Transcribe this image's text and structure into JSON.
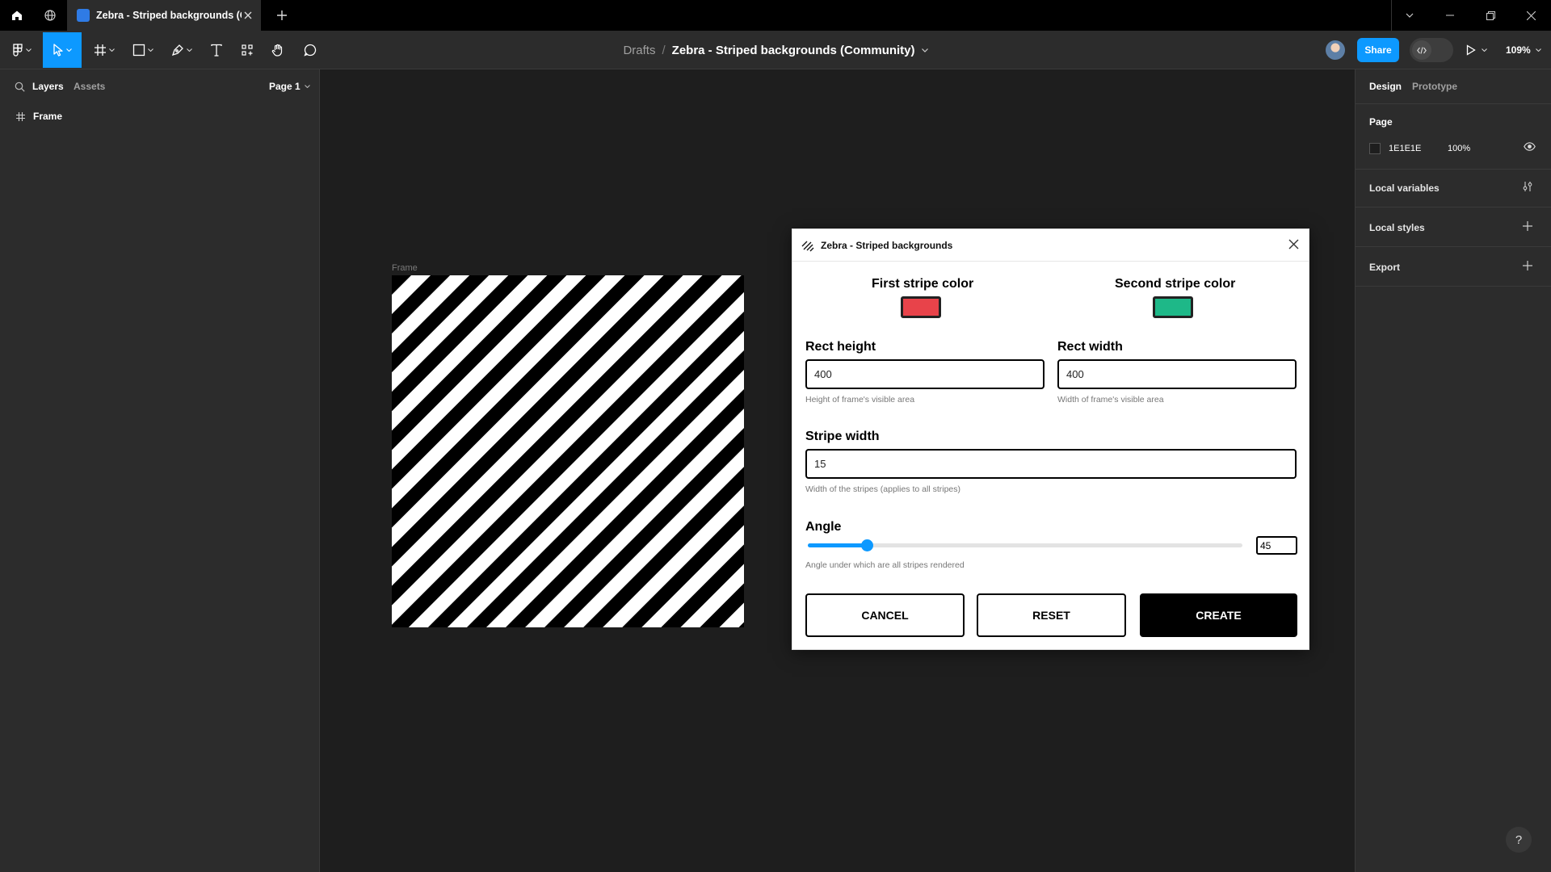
{
  "tabbar": {
    "tab_title": "Zebra - Striped backgrounds (Com",
    "home_icon": "home-icon",
    "community_icon": "globe-icon",
    "new_tab_icon": "plus-icon"
  },
  "toolbar": {
    "breadcrumb_root": "Drafts",
    "breadcrumb_separator": "/",
    "file_name": "Zebra - Striped backgrounds (Community)",
    "share_label": "Share",
    "zoom": "109%",
    "accent": "#0d99ff"
  },
  "left_panel": {
    "tabs": [
      "Layers",
      "Assets"
    ],
    "page_selector": "Page 1",
    "layers": [
      {
        "name": "Frame",
        "icon": "frame-icon"
      }
    ]
  },
  "right_panel": {
    "tabs": [
      "Design",
      "Prototype"
    ],
    "page_heading": "Page",
    "page_color": "1E1E1E",
    "page_opacity": "100%",
    "sections": [
      {
        "label": "Local variables",
        "icon": "adjust-icon"
      },
      {
        "label": "Local styles",
        "icon": "plus-icon"
      },
      {
        "label": "Export",
        "icon": "plus-icon"
      }
    ],
    "help_label": "?"
  },
  "canvas": {
    "frame_label": "Frame",
    "stripe_colors": [
      "#000000",
      "#ffffff"
    ]
  },
  "plugin": {
    "title": "Zebra - Striped backgrounds",
    "first_stripe_label": "First stripe color",
    "first_stripe_color": "#e8434a",
    "second_stripe_label": "Second stripe color",
    "second_stripe_color": "#1eb888",
    "rect_height_label": "Rect height",
    "rect_height_value": "400",
    "rect_height_hint": "Height of frame's visible area",
    "rect_width_label": "Rect width",
    "rect_width_value": "400",
    "rect_width_hint": "Width of frame's visible area",
    "stripe_width_label": "Stripe width",
    "stripe_width_value": "15",
    "stripe_width_hint": "Width of the stripes (applies to all stripes)",
    "angle_label": "Angle",
    "angle_value": "45",
    "angle_slider_fraction": 0.135,
    "angle_hint": "Angle under which are all stripes rendered",
    "cancel_label": "CANCEL",
    "reset_label": "RESET",
    "create_label": "CREATE"
  }
}
